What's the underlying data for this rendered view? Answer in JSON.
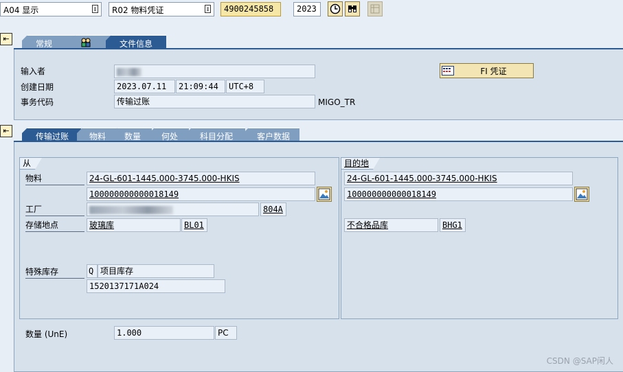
{
  "toolbar": {
    "action": "A04 显示",
    "reference": "R02 物料凭证",
    "document_number": "4900245858",
    "year": "2023"
  },
  "header_tabs": [
    {
      "label": "常规"
    },
    {
      "label": ""
    },
    {
      "label": "文件信息"
    }
  ],
  "header": {
    "entered_by_label": "输入者",
    "created_label": "创建日期",
    "created_date": "2023.07.11",
    "created_time": "21:09:44",
    "timezone": "UTC+8",
    "tcode_label": "事务代码",
    "tcode_text": "传输过账",
    "tcode_value": "MIGO_TR",
    "fi_doc_button": "FI 凭证"
  },
  "item_tabs": [
    {
      "label": "传输过账"
    },
    {
      "label": "物料"
    },
    {
      "label": "数量"
    },
    {
      "label": "何处"
    },
    {
      "label": "科目分配"
    },
    {
      "label": "客户数据"
    }
  ],
  "from": {
    "title": "从",
    "material_label": "物料",
    "material": "24-GL-601-1445.000-3745.000-HKIS",
    "material_number": "100000000000018149",
    "plant_label": "工厂",
    "plant_code": "804A",
    "storage_label": "存储地点",
    "storage_name": "玻璃库",
    "storage_code": "BL01",
    "special_stock_label": "特殊库存",
    "special_stock_ind": "Q",
    "special_stock_text": "项目库存",
    "wbs": "1520137171A024"
  },
  "to": {
    "title": "目的地",
    "material": "24-GL-601-1445.000-3745.000-HKIS",
    "material_number": "100000000000018149",
    "storage_name": "不合格品库",
    "storage_code": "BHG1"
  },
  "quantity": {
    "label": "数量 (UnE)",
    "value": "1.000",
    "unit": "PC"
  },
  "watermark": "CSDN @SAP闲人"
}
